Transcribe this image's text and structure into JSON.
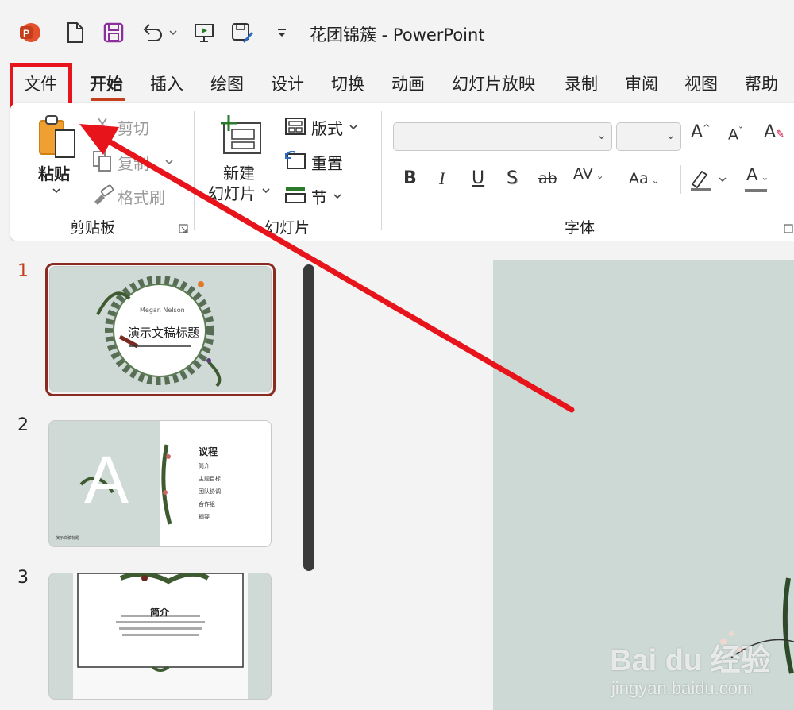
{
  "titlebar": {
    "doc_title": "花团锦簇 - PowerPoint"
  },
  "menu": {
    "tabs": [
      "文件",
      "开始",
      "插入",
      "绘图",
      "设计",
      "切换",
      "动画",
      "幻灯片放映",
      "录制",
      "审阅",
      "视图",
      "帮助"
    ],
    "active_tab": "开始",
    "highlighted_tab": "文件"
  },
  "ribbon": {
    "clipboard": {
      "paste": "粘贴",
      "cut": "剪切",
      "copy": "复制",
      "format_painter": "格式刷",
      "group_label": "剪贴板"
    },
    "slides": {
      "new_slide_line1": "新建",
      "new_slide_line2": "幻灯片",
      "layout": "版式",
      "reset": "重置",
      "section": "节",
      "group_label": "幻灯片"
    },
    "font": {
      "font_name": "",
      "font_size": "",
      "bold": "B",
      "italic": "I",
      "underline": "U",
      "shadow": "S",
      "strike": "ab",
      "spacing": "AV",
      "case": "Aa",
      "color": "A",
      "group_label": "字体"
    }
  },
  "thumbnails": [
    {
      "number": "1",
      "author": "Megan Nelson",
      "title": "演示文稿标题"
    },
    {
      "number": "2",
      "big_letter": "A",
      "title": "议程",
      "items": [
        "简介",
        "主题目标",
        "团队协调",
        "合作组",
        "摘要"
      ],
      "footer": "演示文稿标题"
    },
    {
      "number": "3",
      "title": "简介"
    }
  ],
  "watermark": {
    "brand": "Bai du 经验",
    "url": "jingyan.baidu.com"
  },
  "colors": {
    "accent": "#c43e1c",
    "highlight_red": "#e8141b",
    "slide_bg": "#cdd9d5"
  }
}
